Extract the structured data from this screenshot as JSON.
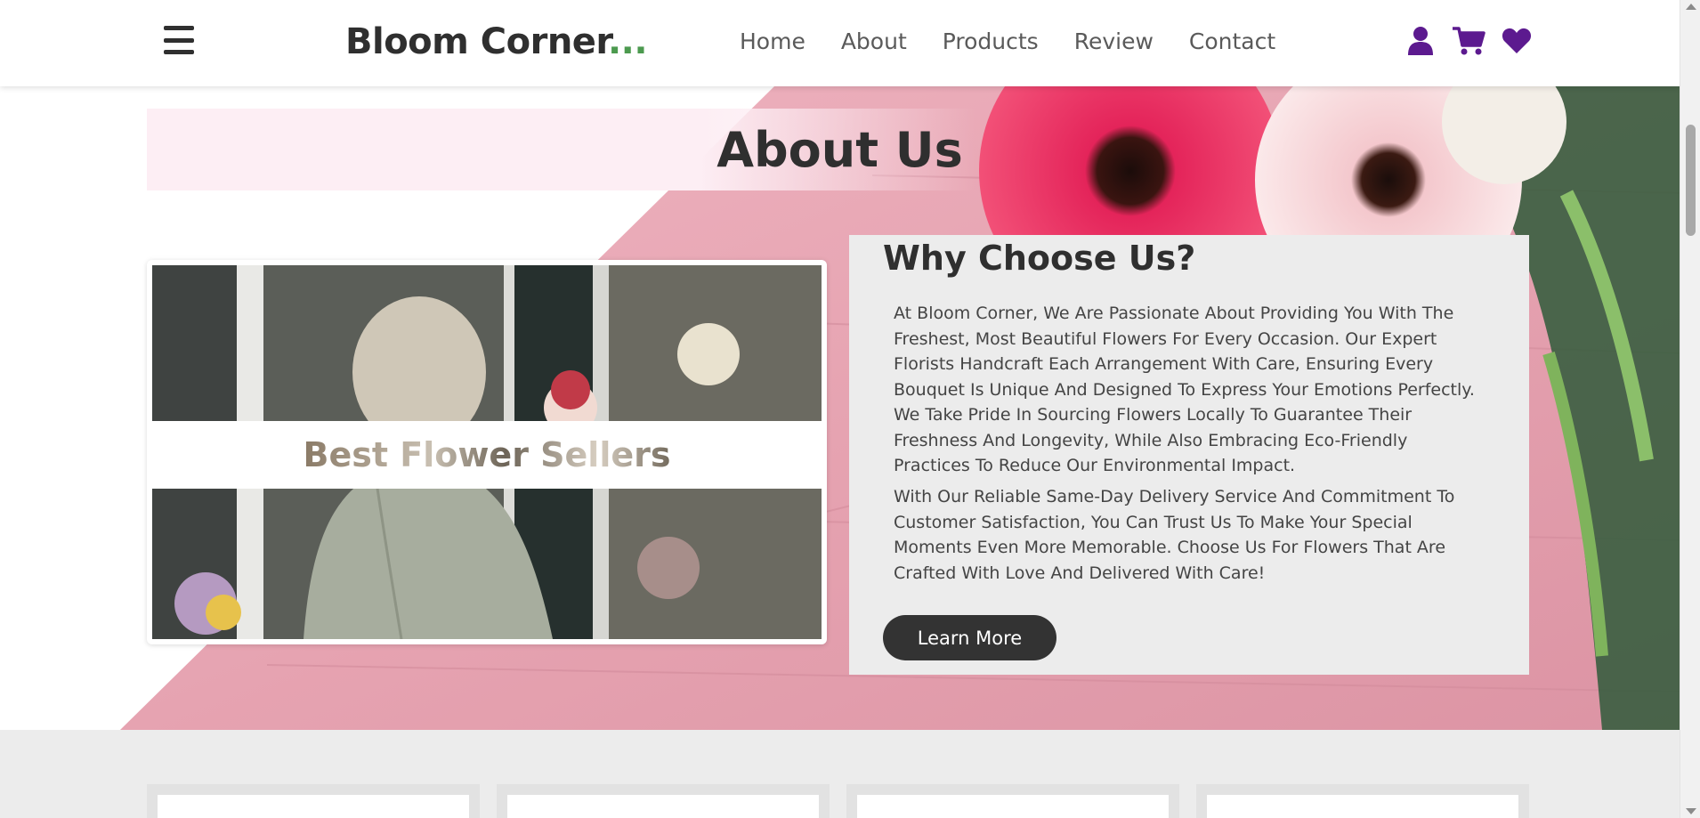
{
  "header": {
    "logo_text": "Bloom Corner",
    "logo_dots": "...",
    "nav": [
      "Home",
      "About",
      "Products",
      "Review",
      "Contact"
    ],
    "icons": [
      "user-icon",
      "cart-icon",
      "heart-icon"
    ],
    "icon_color": "#5c1a8f"
  },
  "about": {
    "title": "About Us",
    "image_caption": "Best Flower Sellers",
    "why_title": "Why Choose Us?",
    "paragraph1": "At Bloom Corner, We Are Passionate About Providing You With The Freshest, Most Beautiful Flowers For Every Occasion. Our Expert Florists Handcraft Each Arrangement With Care, Ensuring Every Bouquet Is Unique And Designed To Express Your Emotions Perfectly. We Take Pride In Sourcing Flowers Locally To Guarantee Their Freshness And Longevity, While Also Embracing Eco-Friendly Practices To Reduce Our Environmental Impact.",
    "paragraph2": "With Our Reliable Same-Day Delivery Service And Commitment To Customer Satisfaction, You Can Trust Us To Make Your Special Moments Even More Memorable. Choose Us For Flowers That Are Crafted With Love And Delivered With Care!",
    "button_label": "Learn More"
  },
  "colors": {
    "accent_purple": "#5c1a8f",
    "logo_dots_green": "#4c9a4f",
    "button_dark": "#333333",
    "pink_background": "#e9a9b5"
  }
}
